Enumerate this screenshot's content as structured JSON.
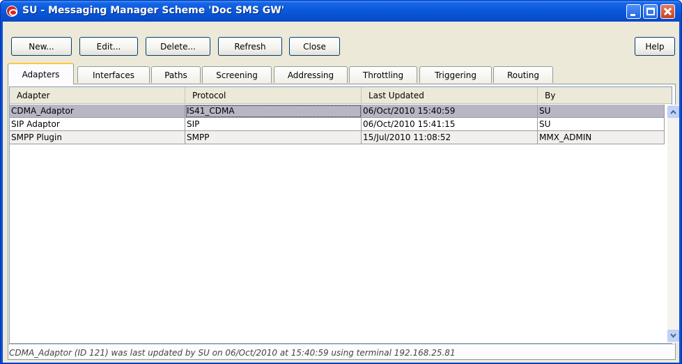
{
  "window": {
    "title": "SU - Messaging Manager Scheme 'Doc SMS GW'"
  },
  "toolbar": {
    "new_label": "New...",
    "edit_label": "Edit...",
    "delete_label": "Delete...",
    "refresh_label": "Refresh",
    "close_label": "Close",
    "help_label": "Help"
  },
  "tabs": [
    {
      "label": "Adapters",
      "active": true
    },
    {
      "label": "Interfaces"
    },
    {
      "label": "Paths"
    },
    {
      "label": "Screening"
    },
    {
      "label": "Addressing"
    },
    {
      "label": "Throttling"
    },
    {
      "label": "Triggering"
    },
    {
      "label": "Routing"
    }
  ],
  "table": {
    "columns": [
      "Adapter",
      "Protocol",
      "Last Updated",
      "By"
    ],
    "rows": [
      [
        "CDMA_Adaptor",
        "IS41_CDMA",
        "06/Oct/2010 15:40:59",
        "SU"
      ],
      [
        "SIP Adaptor",
        "SIP",
        "06/Oct/2010 15:41:15",
        "SU"
      ],
      [
        "SMPP Plugin",
        "SMPP",
        "15/Jul/2010 11:08:52",
        "MMX_ADMIN"
      ]
    ],
    "selected_row": 0
  },
  "status": {
    "text": "CDMA_Adaptor (ID 121) was last updated by SU on 06/Oct/2010 at 15:40:59 using terminal 192.168.25.81"
  },
  "colors": {
    "title_bar": "#0a5adb",
    "client_bg": "#ece9d8",
    "selected_row": "#b8b6c5",
    "active_tab_highlight": "#ffc83c"
  },
  "icons": {
    "app": "oracle-icon",
    "minimize": "minimize-icon",
    "maximize": "maximize-icon",
    "close": "close-icon",
    "scroll_up": "chevron-up-icon",
    "scroll_down": "chevron-down-icon"
  }
}
